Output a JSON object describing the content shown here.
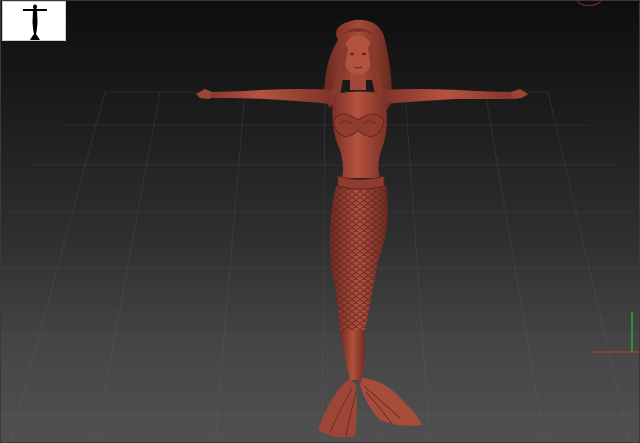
{
  "viewport": {
    "background_top": "#0e0e0e",
    "background_bottom": "#505050",
    "grid_color": "#6a6a6a",
    "model_color": "#a8493c",
    "model_shadow_color": "#6e2a22",
    "model_highlight_color": "#c9705f"
  },
  "thumbnail": {
    "icon": "mermaid-silhouette-icon",
    "background": "#ffffff",
    "silhouette_color": "#000000"
  },
  "axis_gizmo": {
    "x_axis_color": "#c0392b",
    "y_axis_color": "#27c43a"
  }
}
